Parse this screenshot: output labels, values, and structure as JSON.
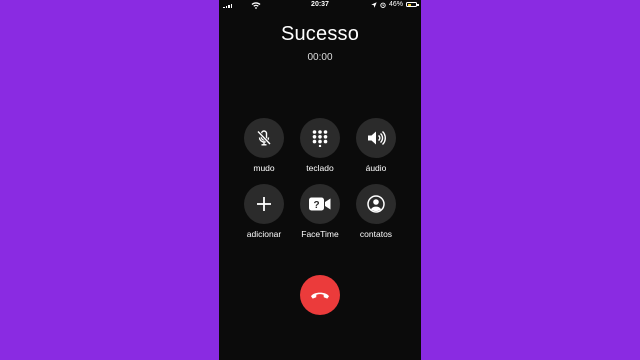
{
  "status_bar": {
    "time": "20:37",
    "battery_percent": "46%",
    "battery_level": 0.46
  },
  "call": {
    "contact_name": "Sucesso",
    "duration": "00:00"
  },
  "controls": {
    "mute": {
      "label": "mudo",
      "icon": "mic-slash-icon"
    },
    "keypad": {
      "label": "teclado",
      "icon": "keypad-icon"
    },
    "audio": {
      "label": "áudio",
      "icon": "speaker-icon"
    },
    "add_call": {
      "label": "adicionar",
      "icon": "plus-icon"
    },
    "facetime": {
      "label": "FaceTime",
      "icon": "facetime-icon"
    },
    "contacts": {
      "label": "contatos",
      "icon": "contact-icon"
    }
  },
  "end_call": {
    "icon": "hang-up-icon",
    "color": "#eb3b3b"
  },
  "colors": {
    "background": "#8a2be2",
    "phone_background": "#0b0b0b",
    "button_background": "#2b2b2b",
    "end_call": "#eb3b3b"
  }
}
